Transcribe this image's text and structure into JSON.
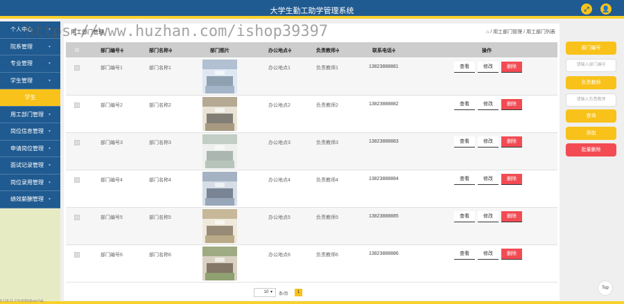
{
  "app": {
    "title": "大学生勤工助学管理系统",
    "icons": [
      "expand-icon",
      "user-icon"
    ]
  },
  "sidebar": {
    "items": [
      {
        "label": "个人中心",
        "name": "sidebar-item-personal"
      },
      {
        "label": "院系管理",
        "name": "sidebar-item-dept-admin"
      },
      {
        "label": "专业管理",
        "name": "sidebar-item-major"
      },
      {
        "label": "学生管理",
        "name": "sidebar-item-student"
      },
      {
        "label": "学生",
        "name": "sidebar-item-students"
      },
      {
        "label": "用工部门管理",
        "name": "sidebar-item-employer-dept"
      },
      {
        "label": "岗位信息管理",
        "name": "sidebar-item-position"
      },
      {
        "label": "申请岗位管理",
        "name": "sidebar-item-apply"
      },
      {
        "label": "面试记录管理",
        "name": "sidebar-item-interview"
      },
      {
        "label": "岗位录用管理",
        "name": "sidebar-item-hire"
      },
      {
        "label": "绩效薪酬管理",
        "name": "sidebar-item-salary"
      }
    ]
  },
  "breadcrumb": {
    "left": "用工部门管理",
    "right": "/ 用工部门管理 / 用工部门列表"
  },
  "table": {
    "headers": [
      "部门编号≑",
      "部门名称≑",
      "部门图片",
      "办公地点≑",
      "负责教师≑",
      "联系电话≑",
      "操作"
    ],
    "rows": [
      {
        "id": "部门编号1",
        "name": "部门名称1",
        "office": "办公地点1",
        "teacher": "负责教师1",
        "phone": "13823888881"
      },
      {
        "id": "部门编号2",
        "name": "部门名称2",
        "office": "办公地点2",
        "teacher": "负责教师2",
        "phone": "13823888882"
      },
      {
        "id": "部门编号3",
        "name": "部门名称3",
        "office": "办公地点3",
        "teacher": "负责教师3",
        "phone": "13823888883"
      },
      {
        "id": "部门编号4",
        "name": "部门名称4",
        "office": "办公地点4",
        "teacher": "负责教师4",
        "phone": "13823888884"
      },
      {
        "id": "部门编号5",
        "name": "部门名称5",
        "office": "办公地点5",
        "teacher": "负责教师5",
        "phone": "13823888885"
      },
      {
        "id": "部门编号6",
        "name": "部门名称6",
        "office": "办公地点6",
        "teacher": "负责教师6",
        "phone": "13823888886"
      }
    ],
    "actions": {
      "view": "查看",
      "edit": "修改",
      "delete": "删除"
    }
  },
  "pagination": {
    "page_size": "10",
    "per_page_label": "条/页",
    "current_page": "1"
  },
  "right_panel": {
    "dept_id_button": "部门编号",
    "dept_id_placeholder": "请输入部门编号",
    "teacher_button": "负责教师",
    "teacher_placeholder": "请输入负责教师",
    "query": "查询",
    "add": "添加",
    "batch_delete": "批量删除"
  },
  "misc": {
    "top": "Top",
    "watermark": "https://www.huzhan.com/ishop39397",
    "status": "8.139.11.174:8090/jfuwu?alj..."
  },
  "colors": {
    "brand_blue": "#1f5a90",
    "accent_yellow": "#f8c21a",
    "danger_red": "#f24b53"
  }
}
